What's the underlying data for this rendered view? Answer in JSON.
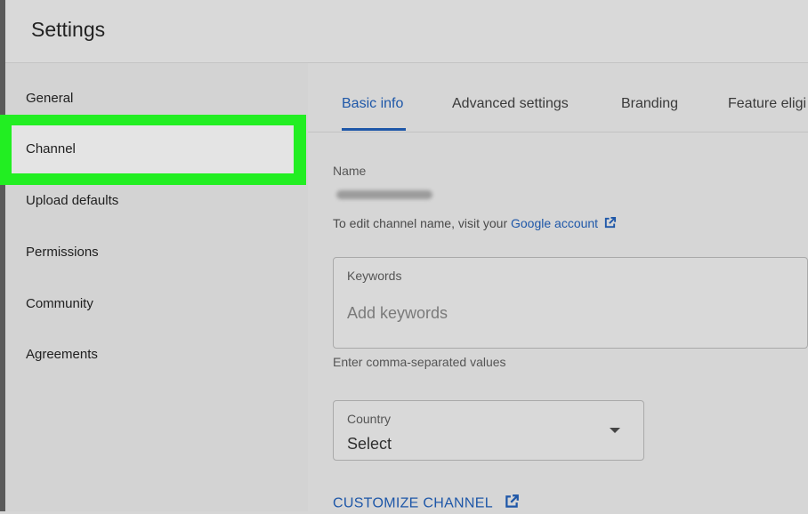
{
  "header": {
    "title": "Settings"
  },
  "sidebar": {
    "items": [
      {
        "label": "General"
      },
      {
        "label": "Channel"
      },
      {
        "label": "Upload defaults"
      },
      {
        "label": "Permissions"
      },
      {
        "label": "Community"
      },
      {
        "label": "Agreements"
      }
    ],
    "selected": "Channel",
    "highlight_color": "#22ee22"
  },
  "tabs": {
    "items": [
      {
        "label": "Basic info"
      },
      {
        "label": "Advanced settings"
      },
      {
        "label": "Branding"
      },
      {
        "label": "Feature eligi"
      }
    ],
    "active": "Basic info",
    "accent_color": "#1e57a8"
  },
  "basic_info": {
    "name_label": "Name",
    "name_helper_prefix": "To edit channel name, visit your",
    "name_helper_link": "Google account",
    "keywords_label": "Keywords",
    "keywords_placeholder": "Add keywords",
    "keywords_helper": "Enter comma-separated values",
    "country_label": "Country",
    "country_value": "Select",
    "customize_link": "CUSTOMIZE CHANNEL"
  },
  "icons": [
    "external-link-icon",
    "chevron-down-icon"
  ]
}
